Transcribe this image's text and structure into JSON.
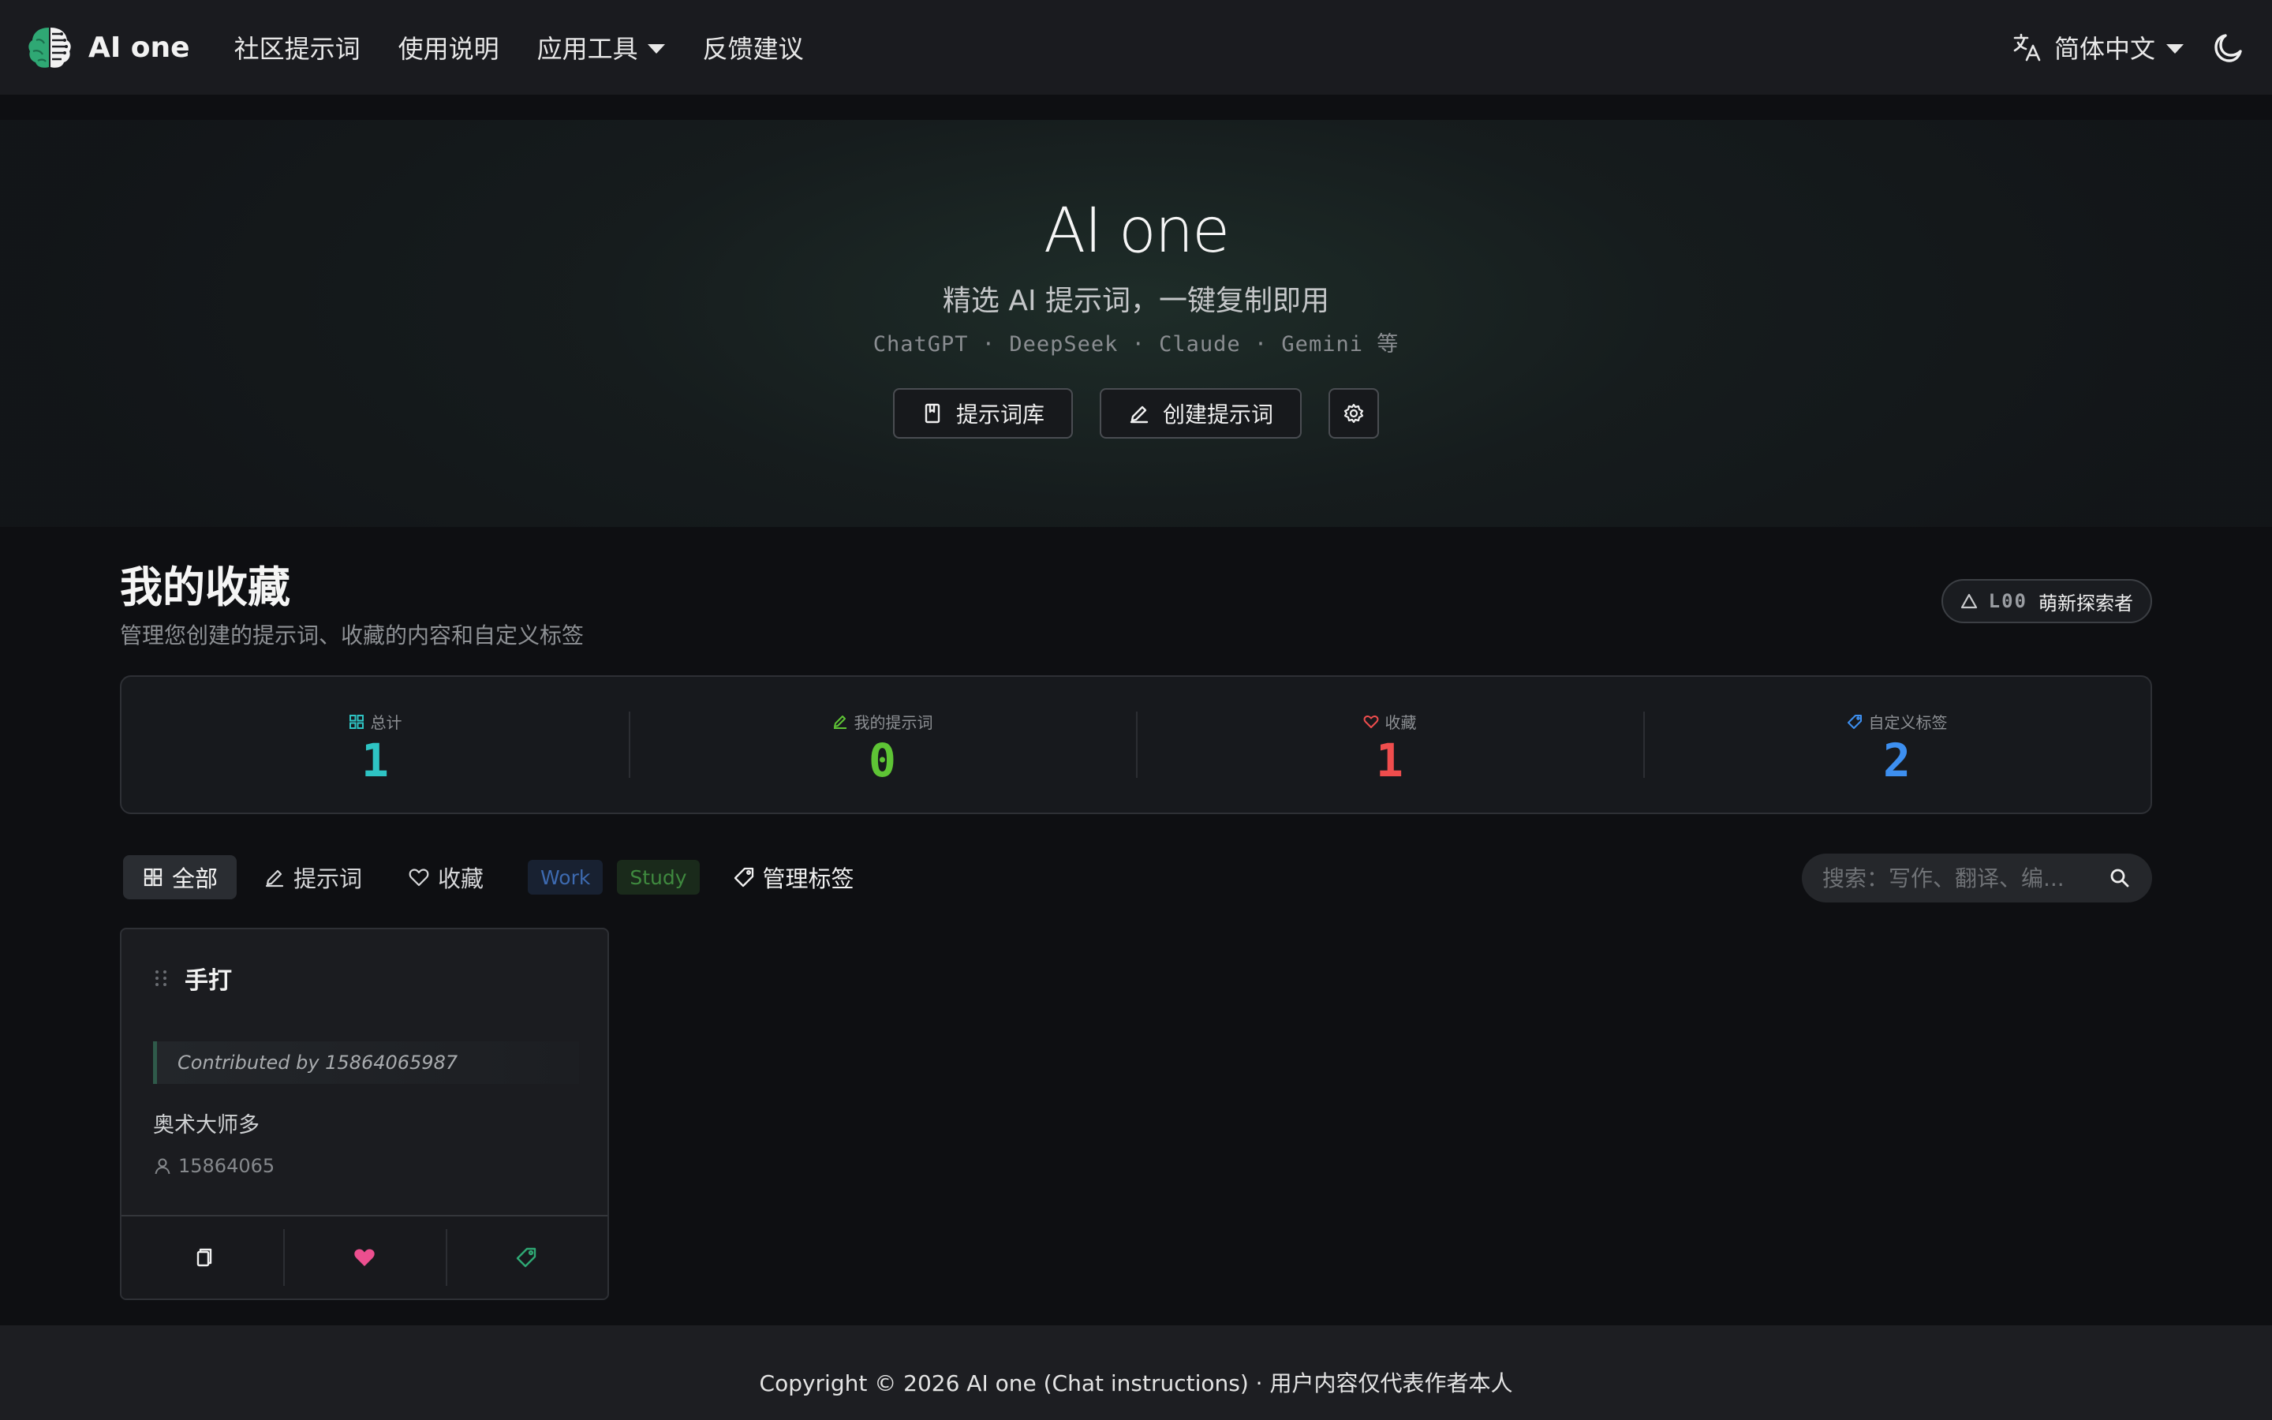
{
  "nav": {
    "brand": "AI one",
    "links": [
      "社区提示词",
      "使用说明",
      "应用工具",
      "反馈建议"
    ],
    "language": "简体中文"
  },
  "hero": {
    "title": "AI one",
    "subtitle": "精选 AI 提示词，一键复制即用",
    "models": "ChatGPT · DeepSeek · Claude · Gemini 等",
    "buttons": {
      "library": "提示词库",
      "create": "创建提示词"
    }
  },
  "section": {
    "title": "我的收藏",
    "description": "管理您创建的提示词、收藏的内容和自定义标签",
    "level": {
      "code": "L00",
      "name": "萌新探索者"
    }
  },
  "stats": [
    {
      "label": "总计",
      "value": "1",
      "color": "#2ec4c4"
    },
    {
      "label": "我的提示词",
      "value": "0",
      "color": "#5ec435"
    },
    {
      "label": "收藏",
      "value": "1",
      "color": "#ef4d4d"
    },
    {
      "label": "自定义标签",
      "value": "2",
      "color": "#3d8ff0"
    }
  ],
  "filters": {
    "all": "全部",
    "prompts": "提示词",
    "favorites": "收藏",
    "tags": [
      "Work",
      "Study"
    ],
    "manage_tags": "管理标签",
    "search_placeholder": "搜索：写作、翻译、编..."
  },
  "card": {
    "title": "手打",
    "contributed": "Contributed by 15864065987",
    "body": "奥术大师多",
    "author": "15864065"
  },
  "footer": {
    "text": "Copyright © 2026 AI one (Chat instructions) · 用户内容仅代表作者本人"
  },
  "colors": {
    "accent_green": "#2fa874",
    "favorite_pink": "#ec4f8f"
  }
}
